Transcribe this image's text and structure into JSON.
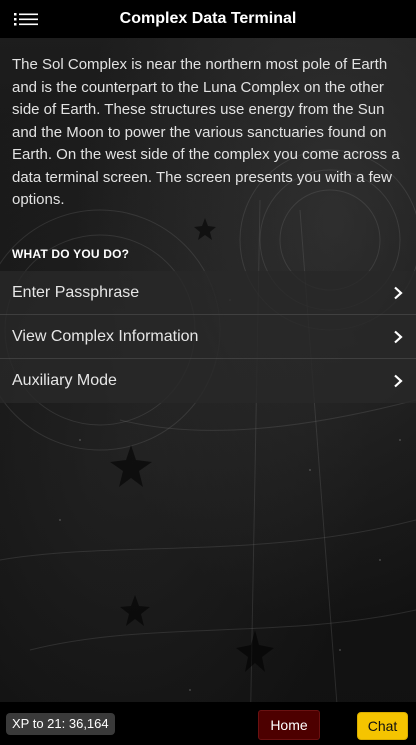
{
  "header": {
    "title": "Complex Data Terminal",
    "menu_icon": "hamburger-menu-icon"
  },
  "intro": {
    "text": "The Sol Complex is near the northern most pole of Earth and is the counterpart to the Luna Complex on the other side of Earth. These structures use energy from the Sun and the Moon to power the various sanctuaries found on Earth. On the west side of the complex you come across a data terminal screen. The screen presents you with a few options."
  },
  "prompt": "WHAT DO YOU DO?",
  "options": [
    {
      "label": "Enter Passphrase",
      "icon": "chevron-right-icon"
    },
    {
      "label": "View Complex Information",
      "icon": "chevron-right-icon"
    },
    {
      "label": "Auxiliary Mode",
      "icon": "chevron-right-icon"
    }
  ],
  "footer": {
    "xp_label": "XP to 21: 36,164",
    "home_label": "Home",
    "chat_label": "Chat"
  },
  "colors": {
    "header_bg": "#000000",
    "home_bg": "#4d0000",
    "chat_bg": "#f5c400",
    "option_bg": "#282828"
  }
}
